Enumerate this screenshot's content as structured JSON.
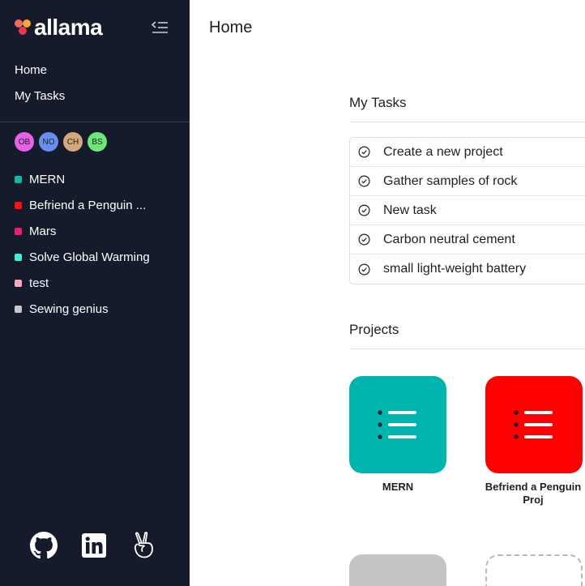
{
  "app": {
    "name": "allama"
  },
  "sidebar": {
    "nav": [
      {
        "label": "Home"
      },
      {
        "label": "My Tasks"
      }
    ],
    "avatars": [
      {
        "initials": "OB",
        "color": "#e562e8"
      },
      {
        "initials": "NO",
        "color": "#6a8df0"
      },
      {
        "initials": "CH",
        "color": "#d4a77d"
      },
      {
        "initials": "BS",
        "color": "#6de67a"
      }
    ],
    "projects": [
      {
        "name": "MERN",
        "color": "#14b8a6"
      },
      {
        "name": "Befriend a Penguin ...",
        "color": "#ff1010"
      },
      {
        "name": "Mars",
        "color": "#e81f76"
      },
      {
        "name": "Solve Global Warming",
        "color": "#3ff0d2"
      },
      {
        "name": "test",
        "color": "#f7aab9"
      },
      {
        "name": "Sewing genius",
        "color": "#c9c9c9"
      }
    ],
    "social_icons": [
      "github-icon",
      "linkedin-icon",
      "angellist-icon"
    ]
  },
  "main": {
    "page_title": "Home",
    "my_tasks": {
      "title": "My Tasks",
      "items": [
        "Create a new project",
        "Gather samples of rock",
        "New task",
        "Carbon neutral cement",
        "small light-weight battery"
      ]
    },
    "projects": {
      "title": "Projects",
      "tiles": [
        {
          "name": "MERN",
          "color": "#00b5ad",
          "icon": "list-icon"
        },
        {
          "name": "Befriend a Penguin Proj",
          "color": "#ff0000",
          "icon": "list-icon"
        }
      ]
    }
  }
}
